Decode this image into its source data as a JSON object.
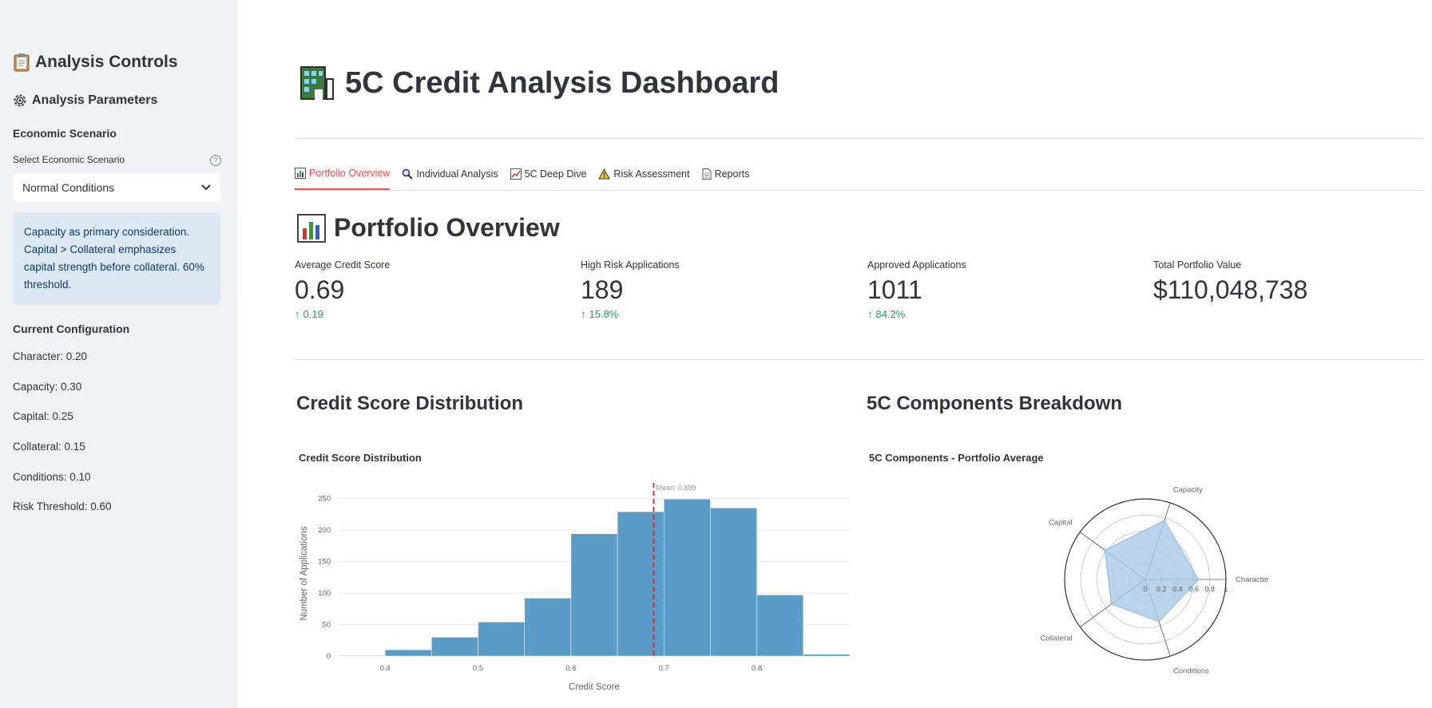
{
  "sidebar": {
    "title": "Analysis Controls",
    "title_icon": "clipboard-icon",
    "params_title": "Analysis Parameters",
    "params_icon": "gear-icon",
    "scenario_heading": "Economic Scenario",
    "select_label": "Select Economic Scenario",
    "select_value": "Normal Conditions",
    "info_text": "Capacity as primary consideration. Capital > Collateral emphasizes capital strength before collateral. 60% threshold.",
    "config_heading": "Current Configuration",
    "config": [
      "Character: 0.20",
      "Capacity: 0.30",
      "Capital: 0.25",
      "Collateral: 0.15",
      "Conditions: 0.10",
      "Risk Threshold: 0.60"
    ]
  },
  "main": {
    "title": "5C Credit Analysis Dashboard",
    "title_icon": "building-icon",
    "tabs": [
      {
        "label": "Portfolio Overview",
        "icon": "bar-chart-icon",
        "active": true
      },
      {
        "label": "Individual Analysis",
        "icon": "magnifier-icon",
        "active": false
      },
      {
        "label": "5C Deep Dive",
        "icon": "trend-chart-icon",
        "active": false
      },
      {
        "label": "Risk Assessment",
        "icon": "warning-icon",
        "active": false
      },
      {
        "label": "Reports",
        "icon": "document-icon",
        "active": false
      }
    ],
    "section_title": "Portfolio Overview",
    "metrics": [
      {
        "label": "Average Credit Score",
        "value": "0.69",
        "delta": "0.19"
      },
      {
        "label": "High Risk Applications",
        "value": "189",
        "delta": "15.8%"
      },
      {
        "label": "Approved Applications",
        "value": "1011",
        "delta": "84.2%"
      },
      {
        "label": "Total Portfolio Value",
        "value": "$110,048,738",
        "delta": ""
      }
    ],
    "dist_heading": "Credit Score Distribution",
    "radar_heading": "5C Components Breakdown",
    "delta_color": "#21a354",
    "accent": "#ff4b4b"
  },
  "chart_data": [
    {
      "type": "bar",
      "title": "Credit Score Distribution",
      "xlabel": "Credit Score",
      "ylabel": "Number of Applications",
      "bin_edges": [
        0.35,
        0.4,
        0.45,
        0.5,
        0.55,
        0.6,
        0.65,
        0.7,
        0.75,
        0.8,
        0.85,
        0.9
      ],
      "values": [
        1,
        10,
        30,
        54,
        92,
        194,
        229,
        249,
        235,
        97,
        3
      ],
      "xticks": [
        0.4,
        0.5,
        0.6,
        0.7,
        0.8
      ],
      "yticks": [
        0,
        50,
        100,
        150,
        200,
        250
      ],
      "xlim": [
        0.35,
        0.9
      ],
      "ylim": [
        0,
        262
      ],
      "mean_line": 0.689,
      "mean_label": "Mean: 0.689",
      "bar_color": "#5b9bc8",
      "mean_color": "#d62728",
      "grid": true
    },
    {
      "type": "radar",
      "title": "5C Components - Portfolio Average",
      "categories": [
        "Character",
        "Capacity",
        "Capital",
        "Collateral",
        "Conditions"
      ],
      "values": [
        0.66,
        0.77,
        0.62,
        0.52,
        0.55
      ],
      "radial_ticks": [
        0,
        0.2,
        0.4,
        0.6,
        0.8,
        1
      ],
      "radial_tick_labels": [
        "0",
        "0.2",
        "0.4",
        "0.6",
        "0.8",
        "1"
      ],
      "range": [
        0,
        1
      ],
      "fill_color": "#a9cbe6"
    }
  ]
}
